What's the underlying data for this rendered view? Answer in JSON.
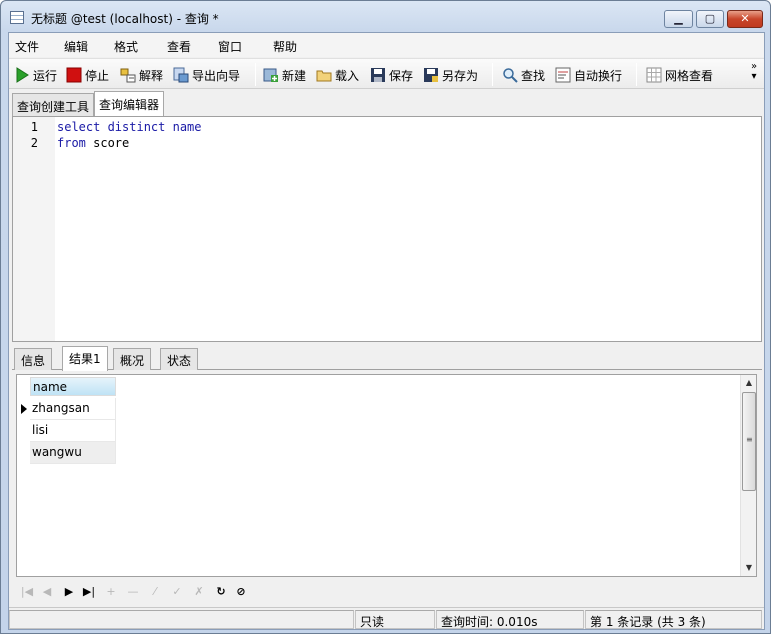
{
  "window": {
    "title": "无标题 @test (localhost) - 查询 *",
    "min_label": "▁",
    "max_label": "▢",
    "close_label": "✕"
  },
  "menu": [
    "文件",
    "编辑",
    "格式",
    "查看",
    "窗口",
    "帮助"
  ],
  "toolbar": {
    "run": "运行",
    "stop": "停止",
    "explain": "解释",
    "export_wizard": "导出向导",
    "new": "新建",
    "load": "载入",
    "save": "保存",
    "save_as": "另存为",
    "find": "查找",
    "word_wrap": "自动换行",
    "grid_view": "网格查看",
    "more": "»"
  },
  "doc_tabs": [
    "查询创建工具",
    "查询编辑器"
  ],
  "editor": {
    "line_numbers": [
      "1",
      "2"
    ],
    "lines": [
      {
        "keyword": "select distinct name",
        "rest": ""
      },
      {
        "keyword": "from",
        "rest": " score"
      }
    ]
  },
  "result_tabs": [
    "信息",
    "结果1",
    "概况",
    "状态"
  ],
  "grid": {
    "column": "name",
    "rows": [
      "zhangsan",
      "lisi",
      "wangwu"
    ]
  },
  "navbar": [
    "|◀",
    "◀",
    "▶",
    "▶|",
    "+",
    "—",
    "✓",
    "✗",
    "↻",
    "⊘"
  ],
  "status": {
    "readonly": "只读",
    "query_time": "查询时间: 0.010s",
    "records": "第 1 条记录 (共 3 条)"
  },
  "colors": {
    "keyword": "#1a1aa6",
    "header_highlight": "#bfe3f5",
    "close_red": "#c8452a",
    "run_green": "#2aa02a",
    "stop_red": "#d01010"
  }
}
